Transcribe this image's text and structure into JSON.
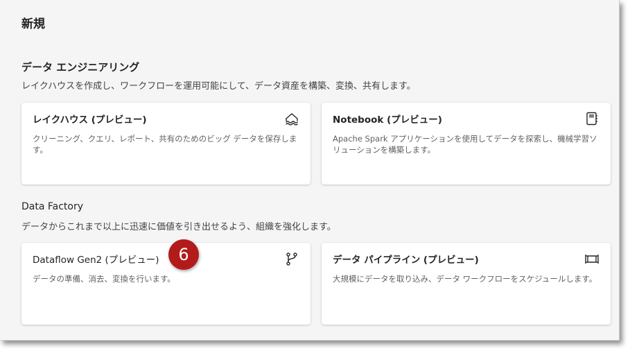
{
  "page_title": "新規",
  "sections": [
    {
      "title": "データ エンジニアリング",
      "description": "レイクハウスを作成し、ワークフローを運用可能にして、データ資産を構築、変換、共有します。",
      "cards": [
        {
          "title": "レイクハウス (プレビュー)",
          "description": "クリーニング、クエリ、レポート、共有のためのビッグ データを保存します。",
          "icon": "lakehouse-icon"
        },
        {
          "title": "Notebook (プレビュー)",
          "description": "Apache Spark アプリケーションを使用してデータを探索し、機械学習ソリューションを構築します。",
          "icon": "notebook-icon"
        }
      ]
    },
    {
      "title": "Data Factory",
      "description": "データからこれまで以上に迅速に価値を引き出せるよう、組織を強化します。",
      "cards": [
        {
          "title": "Dataflow Gen2 (プレビュー)",
          "description": "データの準備、消去、変換を行います。",
          "icon": "dataflow-icon"
        },
        {
          "title": "データ パイプライン (プレビュー)",
          "description": "大規模にデータを取り込み、データ ワークフローをスケジュールします。",
          "icon": "pipeline-icon"
        }
      ]
    }
  ],
  "callout_badge": "6",
  "colors": {
    "badge": "#b31b1b",
    "background": "#f5f5f5",
    "card": "#ffffff"
  }
}
